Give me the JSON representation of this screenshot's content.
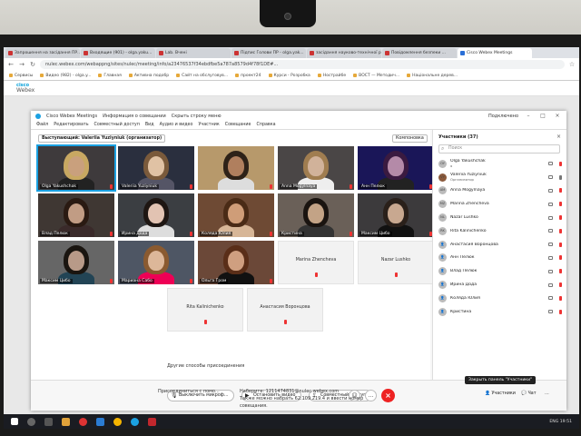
{
  "browser": {
    "tabs": [
      {
        "title": "Запрошення на засідання ПР...",
        "active": false
      },
      {
        "title": "Входящие (901) - olga.yaku...",
        "active": false
      },
      {
        "title": "Lab. Вчені",
        "active": false
      },
      {
        "title": "Підпис Голови ПР - olga.yak...",
        "active": false
      },
      {
        "title": "засідання науково-технічної ради",
        "active": false
      },
      {
        "title": "Повідомлення безпеки ...",
        "active": false
      },
      {
        "title": "Cisco Webex Meetings",
        "active": true
      }
    ],
    "url": "nulec.webex.com/webappng/sites/nulec/meeting/info/a23476537f34ebdfbe5a787a8579d4f78f1DE#...",
    "bookmarks": [
      "Сервисы",
      "Видео (982) - olga.y...",
      "Главная",
      "Aктивна подобр",
      "Сайт на обслуговув...",
      "проект24",
      "Курси - Розробка",
      "Нострайбе",
      "ВОСТ — Методич...",
      "Національне дерев..."
    ]
  },
  "cisco_header": {
    "brand_top": "cisco",
    "brand_bottom": "Webex"
  },
  "app": {
    "title": "Cisco Webex Meetings",
    "info_label": "Информация о совещании",
    "hide_menu": "Скрыть строку меню",
    "connected": "Подключено",
    "menu": [
      "Файл",
      "Редактировать",
      "Совместный доступ",
      "Вид",
      "Аудио и видео",
      "Участник",
      "Совещание",
      "Справка"
    ],
    "speaker_label": "Выступающий: Valeriia Yuziyniuk (организатор)",
    "layout_button": "Компоновка"
  },
  "tiles": [
    {
      "name": "Olga Yakushchak",
      "skin": "#c9a07d",
      "hair": "#c8a862",
      "bg": "#3e3a3c",
      "shirt": "#222"
    },
    {
      "name": "Valeriia Yuziyniuk",
      "skin": "#e0c2a4",
      "hair": "#7a5a3b",
      "bg": "#2a2f3e",
      "shirt": "#556"
    },
    {
      "name": "",
      "skin": "#b07f5e",
      "hair": "#2e2218",
      "bg": "#b7996b",
      "shirt": "#ddd"
    },
    {
      "name": "Anna Mogylnaya",
      "skin": "#d1b29a",
      "hair": "#a07d50",
      "bg": "#4a4646",
      "shirt": "#eee"
    },
    {
      "name": "Анн Пелюк",
      "skin": "#b48aa8",
      "hair": "#3a1a40",
      "bg": "#1a1658",
      "shirt": "#222"
    },
    {
      "name": "Влад Пелюк",
      "skin": "#c19c84",
      "hair": "#2a1a12",
      "bg": "#3f3733",
      "shirt": "#3a2a2a"
    },
    {
      "name": "Ирина Дода",
      "skin": "#e2c3b2",
      "hair": "#1e1612",
      "bg": "#3b3e42",
      "shirt": "#ddd"
    },
    {
      "name": "Коляда Юлия",
      "skin": "#cf9d78",
      "hair": "#4a2b16",
      "bg": "#6e4a34",
      "shirt": "#d7b697"
    },
    {
      "name": "Кристина",
      "skin": "#c3a386",
      "hair": "#1a1410",
      "bg": "#6a6058",
      "shirt": "#333"
    },
    {
      "name": "Максим Цибо",
      "skin": "#c8a890",
      "hair": "#2a201a",
      "bg": "#3c3a3c",
      "shirt": "#111"
    },
    {
      "name": "Максим Цибо",
      "skin": "#b89a88",
      "hair": "#1a1510",
      "bg": "#666",
      "shirt": "#245"
    },
    {
      "name": "Мариана Сабо",
      "skin": "#ddb799",
      "hair": "#8a5a30",
      "bg": "#4e5664",
      "shirt": "#e05"
    },
    {
      "name": "Ольга Гром",
      "skin": "#cf9f80",
      "hair": "#5a2e18",
      "bg": "#6b4838",
      "shirt": "#111"
    },
    {
      "name": "Стельмах Ма...",
      "skin": "#ddc2ad",
      "hair": "#b7935e",
      "bg": "#8a867e",
      "shirt": "#aaa"
    }
  ],
  "empty_tiles": [
    {
      "name": "Marina Zhencheva"
    },
    {
      "name": "Nazar Lushko"
    },
    {
      "name": "Rita Kalinichenko"
    },
    {
      "name": "Анастасия Воронцова"
    }
  ],
  "panel": {
    "title": "Участники (37)",
    "search_placeholder": "Поиск",
    "participants": [
      {
        "initials": "OY",
        "name": "Olga Yakushchak",
        "sub": "я",
        "photo": false,
        "muted": false
      },
      {
        "initials": "VY",
        "name": "Valeriia Yuziyniuk",
        "sub": "Организатор",
        "photo": true,
        "muted": true
      },
      {
        "initials": "AM",
        "name": "Anna Mogylnaya",
        "sub": "",
        "photo": false,
        "muted": false
      },
      {
        "initials": "MZ",
        "name": "Marina Zhencheva",
        "sub": "",
        "photo": false,
        "muted": false
      },
      {
        "initials": "NL",
        "name": "Nazar Lushko",
        "sub": "",
        "photo": false,
        "muted": false
      },
      {
        "initials": "RK",
        "name": "Rita Kalinichenko",
        "sub": "",
        "photo": false,
        "muted": false
      },
      {
        "initials": "",
        "name": "Анастасия Воронцова",
        "sub": "",
        "photo": false,
        "muted": false
      },
      {
        "initials": "",
        "name": "Анн Пелюк",
        "sub": "",
        "photo": false,
        "muted": false
      },
      {
        "initials": "",
        "name": "Влад Пелюк",
        "sub": "",
        "photo": false,
        "muted": false
      },
      {
        "initials": "",
        "name": "Ирина Дода",
        "sub": "",
        "photo": false,
        "muted": false
      },
      {
        "initials": "",
        "name": "Коляда Юлия",
        "sub": "",
        "photo": false,
        "muted": false
      },
      {
        "initials": "",
        "name": "Кристина",
        "sub": "",
        "photo": false,
        "muted": false
      }
    ]
  },
  "controls": {
    "mute": "Выключить микроф...",
    "video": "Остановить видео",
    "share": "Совместный доступ",
    "participants": "Участники",
    "chat": "Чат",
    "tooltip": "Закрыть панель \"Участники\""
  },
  "page_below": {
    "other_ways": "Другие способы присоединения",
    "join_label": "Присоединиться с помо...",
    "dial_line1": "Наберите: 1211474831@nulec.webex.com",
    "dial_line2": "Также можно набрать 62.109.219.4 и ввести номер",
    "dial_line3": "совещания."
  },
  "taskbar": {
    "tray": "ENG  19:51"
  }
}
